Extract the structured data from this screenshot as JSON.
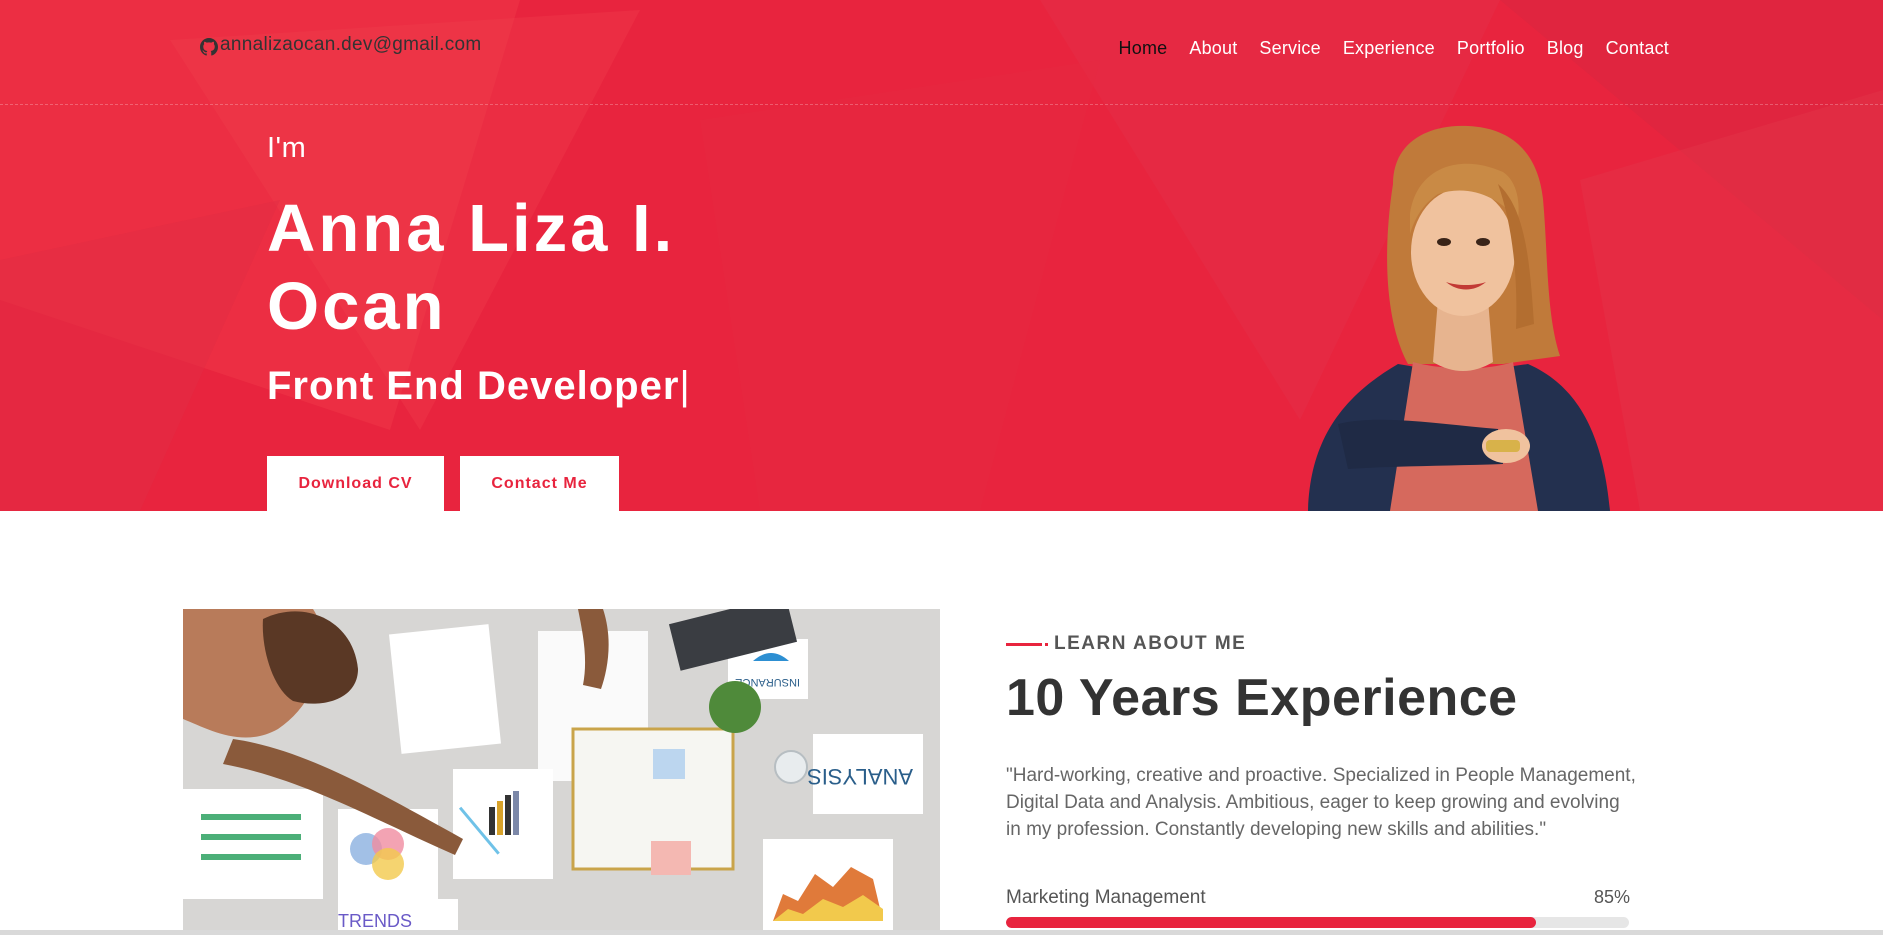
{
  "header": {
    "email": "annalizaocan.dev@gmail.com",
    "nav": [
      {
        "label": "Home",
        "active": true
      },
      {
        "label": "About",
        "active": false
      },
      {
        "label": "Service",
        "active": false
      },
      {
        "label": "Experience",
        "active": false
      },
      {
        "label": "Portfolio",
        "active": false
      },
      {
        "label": "Blog",
        "active": false
      },
      {
        "label": "Contact",
        "active": false
      }
    ]
  },
  "hero": {
    "intro": "I'm",
    "name_line1": "Anna Liza I.",
    "name_line2": "Ocan",
    "role": "Front End Developer",
    "cursor": "|",
    "download_cv_label": "Download CV",
    "contact_me_label": "Contact Me"
  },
  "about": {
    "section_label": "LEARN ABOUT ME",
    "title": "10 Years Experience",
    "description": "\"Hard-working, creative and proactive. Specialized in People Management, Digital Data and Analysis. Ambitious, eager to keep growing and evolving in my profession. Constantly developing new skills and abilities.\"",
    "image_texts": {
      "insurance": "INSURANCE",
      "analysis": "ANALYSIS",
      "trends": "TRENDS"
    },
    "skills": [
      {
        "name": "Marketing Management",
        "percent_label": "85%",
        "value": 0.85
      }
    ]
  },
  "colors": {
    "accent": "#e8243e",
    "nav_active": "#111111",
    "heading": "#333333",
    "body_text": "#666666"
  },
  "icons": {
    "email_icon": "github-icon"
  }
}
